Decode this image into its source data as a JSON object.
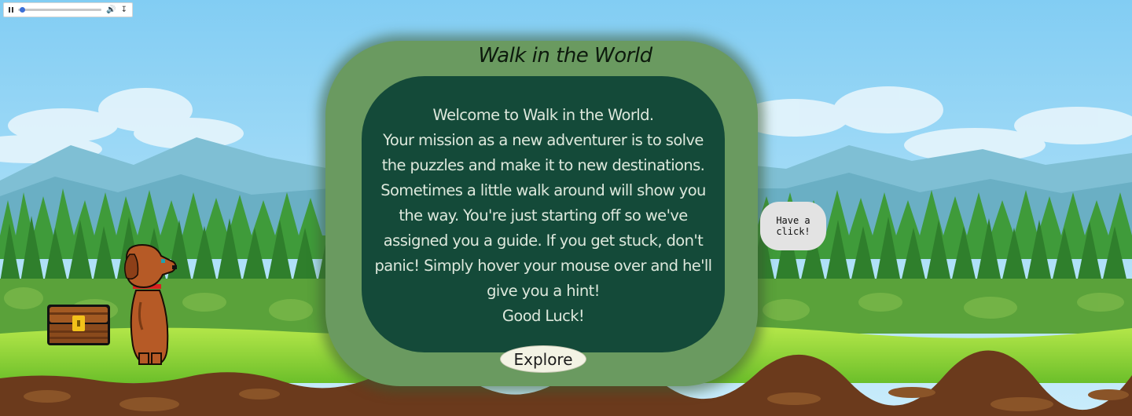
{
  "audio_player": {
    "pause_icon": "pause-icon",
    "volume_icon": "volume-icon",
    "download_icon": "download-icon",
    "progress": 0.02
  },
  "dialog": {
    "title": "Walk in the World",
    "message": "Welcome to Walk in the World.\nYour mission as a new adventurer is to solve the puzzles and make it to new destinations. Sometimes a little walk around will show you the way. You're just starting off so we've assigned you a guide. If you get stuck, don't panic! Simply hover your mouse over and he'll give you a hint!\nGood Luck!",
    "button_label": "Explore"
  },
  "hint_bubble": {
    "text": "Have a click!"
  },
  "colors": {
    "sky": "#8fd3f6",
    "dialog_outer": "#6a9a60",
    "dialog_inner": "#0e4436",
    "grass": "#8ad33a",
    "dirt": "#6b3a1c",
    "dog": "#b65a26",
    "chest": "#8a4a1c"
  }
}
